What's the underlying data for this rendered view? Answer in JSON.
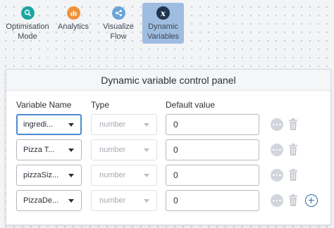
{
  "toolbar": {
    "items": [
      {
        "line1": "Optimisation",
        "line2": "Mode",
        "icon": "search-gear-icon",
        "color": "#1aa6a0"
      },
      {
        "line1": "Analytics",
        "line2": "",
        "icon": "analytics-chart-icon",
        "color": "#f0923a"
      },
      {
        "line1": "Visualize",
        "line2": "Flow",
        "icon": "share-flow-icon",
        "color": "#6aa6d8"
      },
      {
        "line1": "Dynamic",
        "line2": "Variables",
        "icon": "variable-x-icon",
        "color": "#1f3550",
        "glyph": "x",
        "active": true
      }
    ]
  },
  "panel": {
    "title": "Dynamic variable control panel",
    "headers": {
      "name": "Variable Name",
      "type": "Type",
      "default": "Default value"
    },
    "rows": [
      {
        "name": "ingredi...",
        "type": "number",
        "default": "0"
      },
      {
        "name": "Pizza T...",
        "type": "number",
        "default": "0"
      },
      {
        "name": "pizzaSiz...",
        "type": "number",
        "default": "0"
      },
      {
        "name": "PizzaDe...",
        "type": "number",
        "default": "0"
      }
    ]
  },
  "colors": {
    "accent": "#2e6aa8",
    "active_tab": "#9fbde0",
    "focus_border": "#4d8bd0"
  }
}
